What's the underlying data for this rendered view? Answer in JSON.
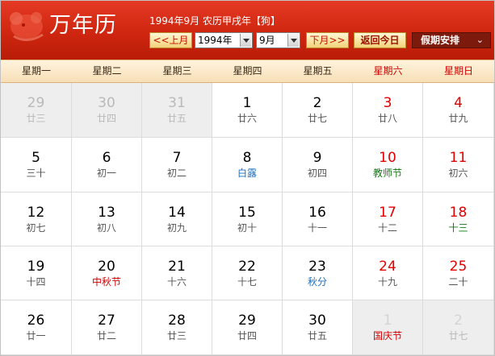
{
  "header": {
    "logo_text": "万年历",
    "subtitle": "1994年9月 农历甲戌年【狗】",
    "prev_button": "<<上月",
    "year_select": "1994年",
    "month_select": "9月",
    "next_button": "下月>>",
    "today_button": "返回今日",
    "holiday_button": "假期安排",
    "holiday_chevron": "⌄"
  },
  "weekdays": [
    "星期一",
    "星期二",
    "星期三",
    "星期四",
    "星期五",
    "星期六",
    "星期日"
  ],
  "colors": {
    "header_red": "#cf2610",
    "weekend_red": "#e00000",
    "solar_term_blue": "#1a6ec2",
    "festival_green": "#117a11"
  },
  "weeks": [
    [
      {
        "day": "29",
        "lunar": "廿三",
        "other": true
      },
      {
        "day": "30",
        "lunar": "廿四",
        "other": true
      },
      {
        "day": "31",
        "lunar": "廿五",
        "other": true
      },
      {
        "day": "1",
        "lunar": "廿六"
      },
      {
        "day": "2",
        "lunar": "廿七"
      },
      {
        "day": "3",
        "lunar": "廿八"
      },
      {
        "day": "4",
        "lunar": "廿九"
      }
    ],
    [
      {
        "day": "5",
        "lunar": "三十"
      },
      {
        "day": "6",
        "lunar": "初一"
      },
      {
        "day": "7",
        "lunar": "初二"
      },
      {
        "day": "8",
        "lunar": "白露",
        "kind": "term"
      },
      {
        "day": "9",
        "lunar": "初四"
      },
      {
        "day": "10",
        "lunar": "教师节",
        "kind": "fest-green"
      },
      {
        "day": "11",
        "lunar": "初六"
      }
    ],
    [
      {
        "day": "12",
        "lunar": "初七"
      },
      {
        "day": "13",
        "lunar": "初八"
      },
      {
        "day": "14",
        "lunar": "初九"
      },
      {
        "day": "15",
        "lunar": "初十"
      },
      {
        "day": "16",
        "lunar": "十一"
      },
      {
        "day": "17",
        "lunar": "十二"
      },
      {
        "day": "18",
        "lunar": "十三",
        "kind": "fest-green"
      }
    ],
    [
      {
        "day": "19",
        "lunar": "十四"
      },
      {
        "day": "20",
        "lunar": "中秋节",
        "kind": "fest-red"
      },
      {
        "day": "21",
        "lunar": "十六"
      },
      {
        "day": "22",
        "lunar": "十七"
      },
      {
        "day": "23",
        "lunar": "秋分",
        "kind": "term"
      },
      {
        "day": "24",
        "lunar": "十九"
      },
      {
        "day": "25",
        "lunar": "二十"
      }
    ],
    [
      {
        "day": "26",
        "lunar": "廿一"
      },
      {
        "day": "27",
        "lunar": "廿二"
      },
      {
        "day": "28",
        "lunar": "廿三"
      },
      {
        "day": "29",
        "lunar": "廿四"
      },
      {
        "day": "30",
        "lunar": "廿五"
      },
      {
        "day": "1",
        "lunar": "国庆节",
        "kind": "fest-red",
        "other": true
      },
      {
        "day": "2",
        "lunar": "廿七",
        "other": true
      }
    ]
  ]
}
